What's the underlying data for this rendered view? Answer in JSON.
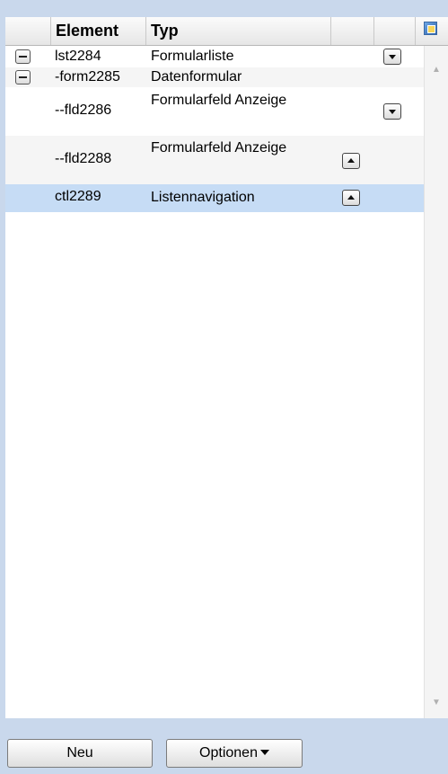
{
  "header": {
    "element": "Element",
    "typ": "Typ"
  },
  "rows": [
    {
      "element": "lst2284",
      "typ": "Formularliste",
      "toggle": "collapse",
      "arrow": "down",
      "selected": false
    },
    {
      "element": "-form2285",
      "typ": "Datenformular",
      "toggle": "collapse",
      "arrow": "",
      "selected": false
    },
    {
      "element": "--fld2286",
      "typ": "Formularfeld Anzeige",
      "toggle": "",
      "arrow": "down",
      "selected": false
    },
    {
      "element": "--fld2288",
      "typ": "Formularfeld Anzeige",
      "toggle": "",
      "arrow": "up",
      "selected": false
    },
    {
      "element": "ctl2289",
      "typ": "Listennavigation",
      "toggle": "",
      "arrow": "up",
      "selected": true
    }
  ],
  "buttons": {
    "neu": "Neu",
    "optionen": "Optionen"
  },
  "colors": {
    "selection": "#c6dcf5",
    "panel_background": "#c9d8ec"
  }
}
